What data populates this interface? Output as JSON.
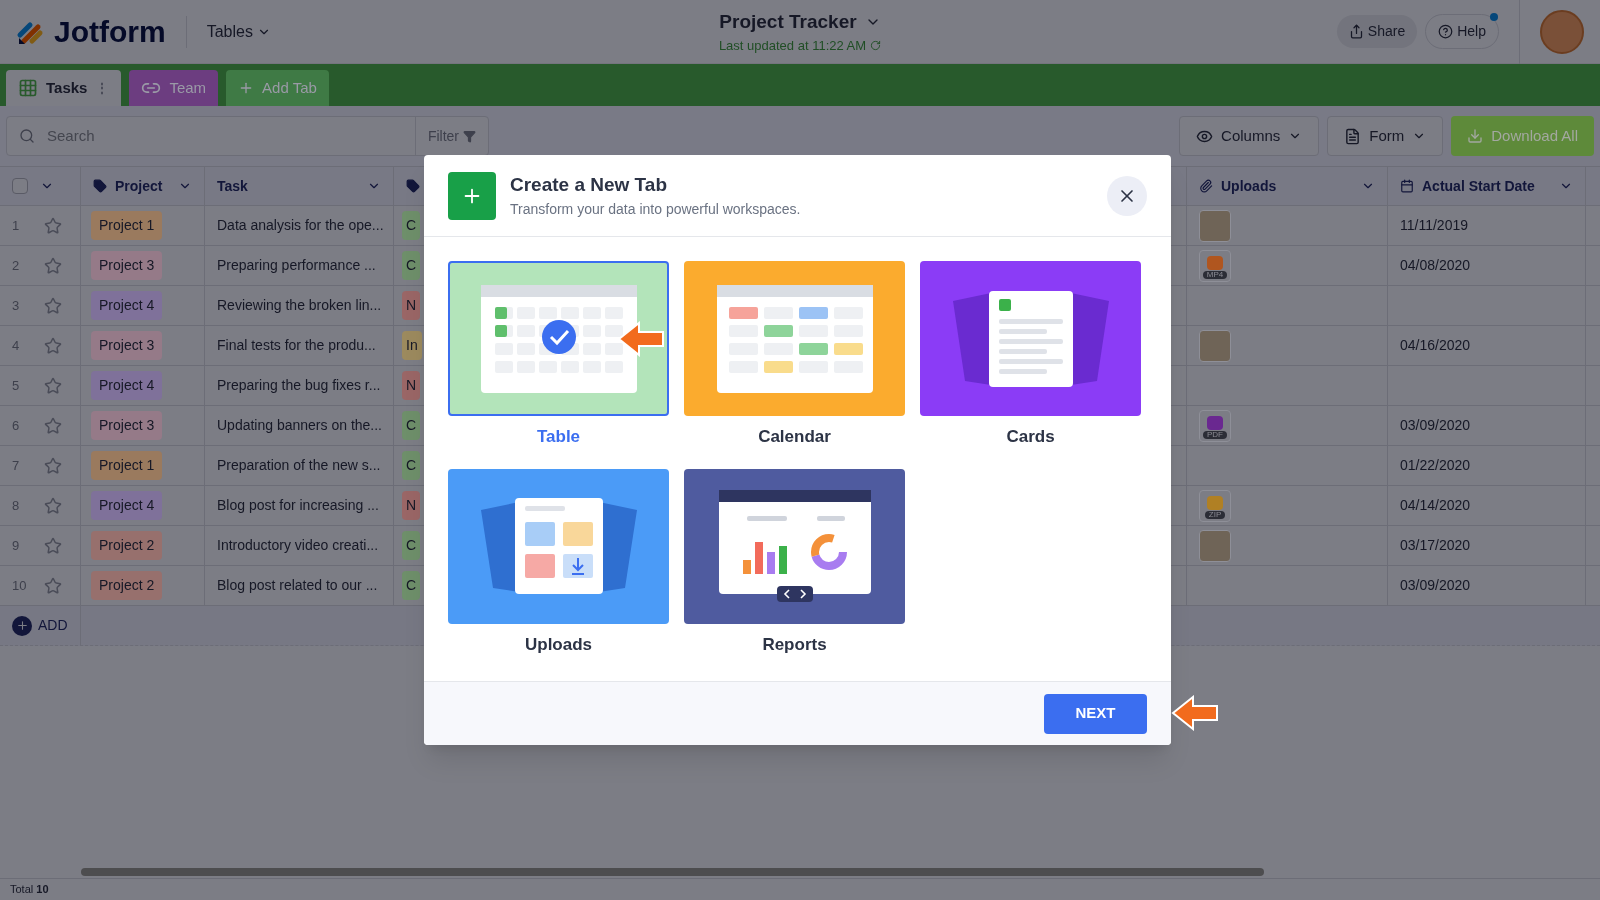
{
  "header": {
    "brand": "Jotform",
    "section": "Tables",
    "title": "Project Tracker",
    "updated": "Last updated at 11:22 AM",
    "share": "Share",
    "help": "Help"
  },
  "tabs": [
    {
      "label": "Tasks",
      "kind": "sheet",
      "selected": true,
      "menu": "⋮",
      "color": "#7c7d85"
    },
    {
      "label": "Team",
      "kind": "link",
      "selected": false,
      "color": "#6c3d80"
    },
    {
      "label": "Add Tab",
      "kind": "add",
      "selected": false,
      "color": "#3f7a45"
    }
  ],
  "toolbar": {
    "search": {
      "placeholder": "Search"
    },
    "filter": "Filter",
    "columns": "Columns",
    "form": "Form",
    "download": "Download All"
  },
  "table": {
    "select_all": {
      "checked": false
    },
    "columns": [
      "Project",
      "Task",
      "Uploads",
      "Actual Start Date"
    ],
    "rows": [
      {
        "num": "1",
        "starred": false,
        "project": {
          "label": "Project 1",
          "color": "#9a7a5e"
        },
        "task": "Data analysis for the ope...",
        "status": {
          "label": "C",
          "color": "#6e8f6a"
        },
        "upload": {
          "kind": "image"
        },
        "date": "11/11/2019"
      },
      {
        "num": "2",
        "starred": false,
        "project": {
          "label": "Project 3",
          "color": "#957a88"
        },
        "task": "Preparing performance ...",
        "status": {
          "label": "C",
          "color": "#6e8f6a"
        },
        "upload": {
          "kind": "file",
          "label": "MP4",
          "color": "#b0561f"
        },
        "date": "04/08/2020"
      },
      {
        "num": "3",
        "starred": false,
        "project": {
          "label": "Project 4",
          "color": "#7f719a"
        },
        "task": "Reviewing the broken lin...",
        "status": {
          "label": "N",
          "color": "#9a6666"
        }
      },
      {
        "num": "4",
        "starred": false,
        "project": {
          "label": "Project 3",
          "color": "#957a88"
        },
        "task": "Final tests for the produ...",
        "status": {
          "label": "In",
          "color": "#9c8a5e"
        },
        "upload": {
          "kind": "image"
        },
        "date": "04/16/2020"
      },
      {
        "num": "5",
        "starred": false,
        "project": {
          "label": "Project 4",
          "color": "#7f719a"
        },
        "task": "Preparing the bug fixes r...",
        "status": {
          "label": "N",
          "color": "#9a6666"
        }
      },
      {
        "num": "6",
        "starred": false,
        "project": {
          "label": "Project 3",
          "color": "#957a88"
        },
        "task": "Updating banners on the...",
        "status": {
          "label": "C",
          "color": "#6e8f6a"
        },
        "upload": {
          "kind": "file",
          "label": "PDF",
          "color": "#6a2890"
        },
        "date": "03/09/2020"
      },
      {
        "num": "7",
        "starred": false,
        "project": {
          "label": "Project 1",
          "color": "#9a7a5e"
        },
        "task": "Preparation of the new s...",
        "status": {
          "label": "C",
          "color": "#6e8f6a"
        },
        "date": "01/22/2020"
      },
      {
        "num": "8",
        "starred": false,
        "project": {
          "label": "Project 4",
          "color": "#7f719a"
        },
        "task": "Blog post for increasing ...",
        "status": {
          "label": "N",
          "color": "#9a6666"
        },
        "upload": {
          "kind": "file",
          "label": "ZIP",
          "color": "#b08024"
        },
        "date": "04/14/2020"
      },
      {
        "num": "9",
        "starred": false,
        "project": {
          "label": "Project 2",
          "color": "#97706d"
        },
        "task": "Introductory video creati...",
        "status": {
          "label": "C",
          "color": "#6e8f6a"
        },
        "upload": {
          "kind": "image"
        },
        "date": "03/17/2020"
      },
      {
        "num": "10",
        "starred": false,
        "project": {
          "label": "Project 2",
          "color": "#97706d"
        },
        "task": "Blog post related to our ...",
        "status": {
          "label": "C",
          "color": "#6e8f6a"
        },
        "date": "03/09/2020"
      }
    ],
    "add": "ADD"
  },
  "footer": {
    "total": "Total **10**"
  },
  "modal": {
    "title": "Create a New Tab",
    "subtitle": "Transform your data into powerful workspaces.",
    "options": [
      {
        "label": "Table",
        "kind": "table",
        "selected": true,
        "color": "#b3e4ba"
      },
      {
        "label": "Calendar",
        "kind": "calendar",
        "selected": false,
        "color": "#fbab2e"
      },
      {
        "label": "Cards",
        "kind": "cards",
        "selected": false,
        "color": "#8b3cf6"
      },
      {
        "label": "Uploads",
        "kind": "uploads",
        "selected": false,
        "color": "#4b9bf7"
      },
      {
        "label": "Reports",
        "kind": "reports",
        "selected": false,
        "color": "#4f5b9f"
      }
    ],
    "next": "NEXT"
  }
}
